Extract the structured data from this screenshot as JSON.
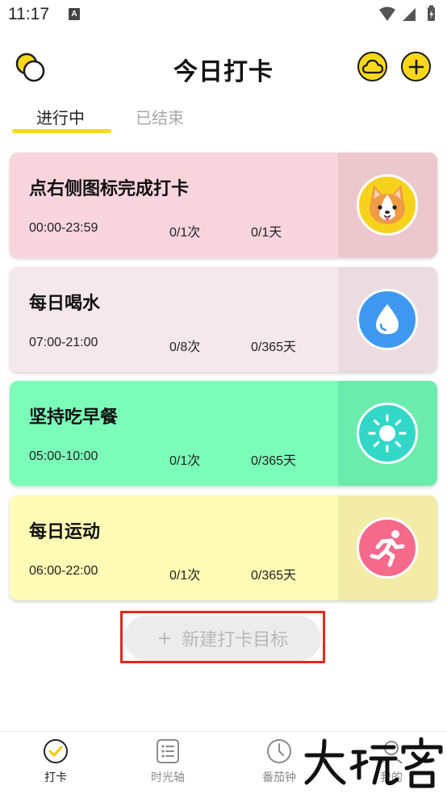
{
  "status_bar": {
    "time": "11:17",
    "notification_letter": "A"
  },
  "header": {
    "title": "今日打卡"
  },
  "tabs": [
    {
      "label": "进行中",
      "active": true
    },
    {
      "label": "已结束",
      "active": false
    }
  ],
  "cards": [
    {
      "title": "点右侧图标完成打卡",
      "time": "00:00-23:59",
      "count": "0/1次",
      "days": "0/1天",
      "icon": "corgi-dog-icon",
      "bg": "#f8d5dc",
      "side": "#ecc7ce",
      "icon_bg": "#f7d21c"
    },
    {
      "title": "每日喝水",
      "time": "07:00-21:00",
      "count": "0/8次",
      "days": "0/365天",
      "icon": "water-drop-icon",
      "bg": "#f5e8ec",
      "side": "#eadce1",
      "icon_bg": "#3e98f0"
    },
    {
      "title": "坚持吃早餐",
      "time": "05:00-10:00",
      "count": "0/1次",
      "days": "0/365天",
      "icon": "sun-icon",
      "bg": "#7bfdb9",
      "side": "#6becad",
      "icon_bg": "#32d7c7"
    },
    {
      "title": "每日运动",
      "time": "06:00-22:00",
      "count": "0/1次",
      "days": "0/365天",
      "icon": "running-person-icon",
      "bg": "#fffcb6",
      "side": "#f2eca7",
      "icon_bg": "#f5698b"
    }
  ],
  "new_goal": {
    "plus": "+",
    "label": "新建打卡目标"
  },
  "bottom_nav": [
    {
      "label": "打卡",
      "icon": "checkin-icon",
      "active": true
    },
    {
      "label": "时光轴",
      "icon": "timeline-list-icon",
      "active": false
    },
    {
      "label": "番茄钟",
      "icon": "clock-icon",
      "active": false
    },
    {
      "label": "我的",
      "icon": "profile-icon",
      "active": false
    }
  ],
  "watermark": {
    "text": "大玩客"
  },
  "colors": {
    "accent_yellow": "#f5dc15",
    "highlight_red": "#e02a1f"
  }
}
